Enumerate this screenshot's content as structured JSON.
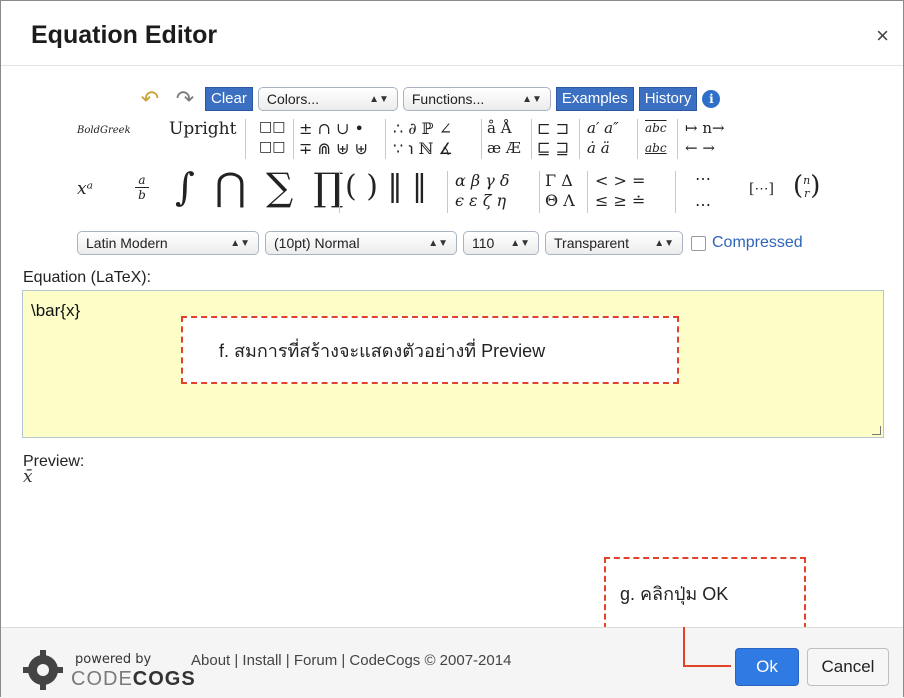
{
  "dialog": {
    "title": "Equation Editor",
    "close_glyph": "×"
  },
  "toolbar": {
    "undo_glyph": "↶",
    "redo_glyph": "↷",
    "clear_label": "Clear",
    "colors_value": "Colors...",
    "functions_value": "Functions...",
    "examples_label": "Examples",
    "history_label": "History",
    "info_glyph": "i"
  },
  "palette": {
    "bold_greek": "BoldGreek",
    "upright": "Upright",
    "boxes": [
      "□□",
      "□□"
    ],
    "binops_row1": "± ∩ ∪ •",
    "binops_row2": "∓ ⋒ ⊎ ⊎",
    "logic_row1": "∴ ∂ ℙ ∠",
    "logic_row2": "∵ ℩ ℕ ∡",
    "accents_row1": "å Å",
    "accents_row2": "æ Æ",
    "sets_row1": "⊏ ⊐",
    "sets_row2": "⊑ ⊒",
    "primes_row1": "a′ a″",
    "primes_row2": "ȧ ä",
    "wide_row1": "abc",
    "wide_row2": "abc",
    "arrows_row1": "↦ n→",
    "arrows_row2": "← →",
    "big_power": "xᵃ",
    "big_frac_num": "a",
    "big_frac_den": "b",
    "big_ops": "∫ ⋂ ∑ ∏",
    "brackets": "( ) ‖ ‖",
    "greek_row1": "α β γ δ",
    "greek_row2": "ϵ ε ζ η",
    "cap_greek_row1": "Γ Δ",
    "cap_greek_row2": "Θ Λ",
    "rel_row1": "< > =",
    "rel_row2": "≤ ≥ ≐",
    "dots_row1": "⋯",
    "dots_row2": "…",
    "matrix": "[⋯]",
    "binom_top": "n",
    "binom_bottom": "r"
  },
  "options": {
    "font": "Latin Modern",
    "size": "(10pt) Normal",
    "dpi": "110",
    "background": "Transparent",
    "compressed_label": "Compressed"
  },
  "editor": {
    "label": "Equation (LaTeX):",
    "value": "\\bar{x}"
  },
  "callout_f": "f. สมการที่สร้างจะแสดงตัวอย่างที่ Preview",
  "preview": {
    "label": "Preview:",
    "rendered": "x̄"
  },
  "callout_g": "g. คลิกปุ่ม OK",
  "footer": {
    "powered_by": "powered by",
    "brand_light": "CODE",
    "brand_bold": "COGS",
    "links": "About | Install | Forum | CodeCogs © 2007-2014",
    "ok_label": "Ok",
    "cancel_label": "Cancel"
  },
  "colors": {
    "accent_blue": "#3a6fc2",
    "editor_bg": "#fdfdc8",
    "callout_red": "#e0422a"
  }
}
